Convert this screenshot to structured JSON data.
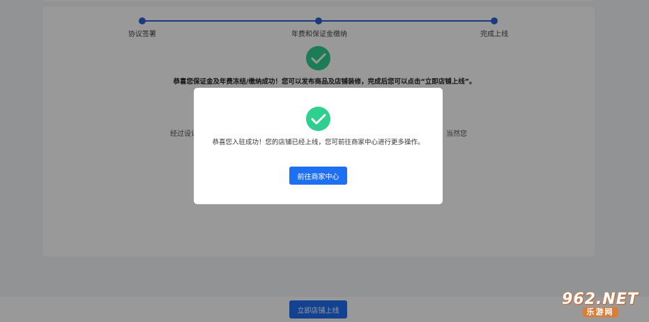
{
  "steps": {
    "items": [
      {
        "label": "协议签署"
      },
      {
        "label": "年费和保证金缴纳"
      },
      {
        "label": "完成上线"
      }
    ]
  },
  "page": {
    "success_message": "恭喜您保证金及年费冻结/缴纳成功！您可以发布商品及店铺装修，完成后您可以点击“立即店铺上线”。",
    "side_text_left": "经过设计",
    "side_text_right": "当然您",
    "go_live_button": "立即店铺上线"
  },
  "modal": {
    "message": "恭喜您入驻成功！您的店铺已经上线，您可前往商家中心进行更多操作。",
    "button_label": "前往商家中心"
  },
  "watermark": {
    "top": "962.NET",
    "bottom": "乐游网"
  },
  "colors": {
    "accent": "#1f6ff2",
    "step": "#2f61d6",
    "success": "#2ecf8f"
  }
}
